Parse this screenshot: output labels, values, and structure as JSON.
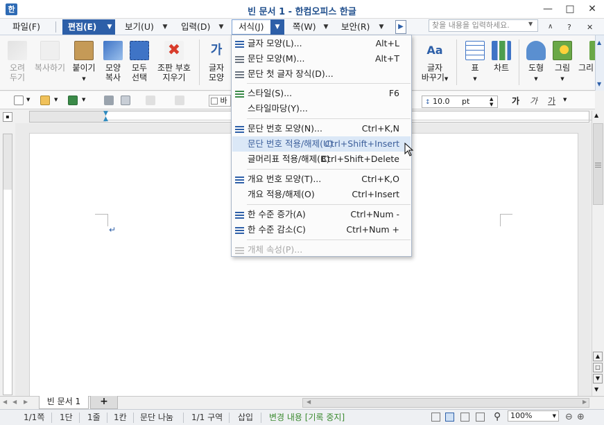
{
  "window": {
    "title": "빈 문서 1 - 한컴오피스 한글",
    "app_icon_glyph": "한"
  },
  "menubar": {
    "file": "파일(F)",
    "edit": "편집(E)",
    "view": "보기(U)",
    "insert": "입력(D)",
    "format": "서식(J)",
    "page": "쪽(W)",
    "security": "보안(R)",
    "search_placeholder": "찾을 내용을 입력하세요."
  },
  "toolbar": {
    "cut": [
      "오려",
      "두기"
    ],
    "copy": "복사하기",
    "paste": "붙이기",
    "format_copy": [
      "모양",
      "복사"
    ],
    "select_all": [
      "모두",
      "선택"
    ],
    "clear_code": [
      "조판 부호",
      "지우기"
    ],
    "char_shape": [
      "글자",
      "모양"
    ],
    "char_replace": [
      "글자",
      "바꾸기"
    ],
    "table": "표",
    "chart": "차트",
    "shape": "도형",
    "picture": "그림",
    "more": "그리"
  },
  "formatbar": {
    "style_value": "바",
    "font_size": "10.0",
    "unit": "pt",
    "bold": "가",
    "italic": "가",
    "underline": "가"
  },
  "format_menu": {
    "items": [
      {
        "icon": "char-shape-icon",
        "label": "글자 모양(L)...",
        "shortcut": "Alt+L",
        "state": "normal"
      },
      {
        "icon": "para-shape-icon",
        "label": "문단 모양(M)...",
        "shortcut": "Alt+T",
        "state": "normal"
      },
      {
        "icon": "drop-cap-icon",
        "label": "문단 첫 글자 장식(D)...",
        "shortcut": "",
        "state": "normal"
      },
      {
        "icon": "style-icon",
        "label": "스타일(S)...",
        "shortcut": "F6",
        "state": "normal"
      },
      {
        "icon": "",
        "label": "스타일마당(Y)...",
        "shortcut": "",
        "state": "normal"
      },
      {
        "icon": "para-number-icon",
        "label": "문단 번호 모양(N)...",
        "shortcut": "Ctrl+K,N",
        "state": "normal"
      },
      {
        "icon": "",
        "label": "문단 번호 적용/해제(U)",
        "shortcut": "Ctrl+Shift+Insert",
        "state": "highlighted"
      },
      {
        "icon": "",
        "label": "글머리표 적용/해제(B)",
        "shortcut": "Ctrl+Shift+Delete",
        "state": "normal"
      },
      {
        "icon": "outline-number-icon",
        "label": "개요 번호 모양(T)...",
        "shortcut": "Ctrl+K,O",
        "state": "normal"
      },
      {
        "icon": "",
        "label": "개요 적용/해제(O)",
        "shortcut": "Ctrl+Insert",
        "state": "normal"
      },
      {
        "icon": "level-up-icon",
        "label": "한 수준 증가(A)",
        "shortcut": "Ctrl+Num -",
        "state": "normal"
      },
      {
        "icon": "level-down-icon",
        "label": "한 수준 감소(C)",
        "shortcut": "Ctrl+Num +",
        "state": "normal"
      },
      {
        "icon": "object-props-icon",
        "label": "개체 속성(P)...",
        "shortcut": "",
        "state": "disabled"
      }
    ]
  },
  "tabs": {
    "doc_tab": "빈 문서 1",
    "add_tab": "+"
  },
  "statusbar": {
    "page": "1/1쪽",
    "column": "1단",
    "line": "1줄",
    "char": "1칸",
    "para_break": "문단 나눔",
    "section": "1/1 구역",
    "insert_mode": "삽입",
    "track_changes": "변경 내용 [기록 중지]",
    "zoom": "100%"
  },
  "colors": {
    "accent": "#2d5fa8",
    "highlight": "#dbe8f7",
    "track_changes_text": "#3a8a2e"
  }
}
